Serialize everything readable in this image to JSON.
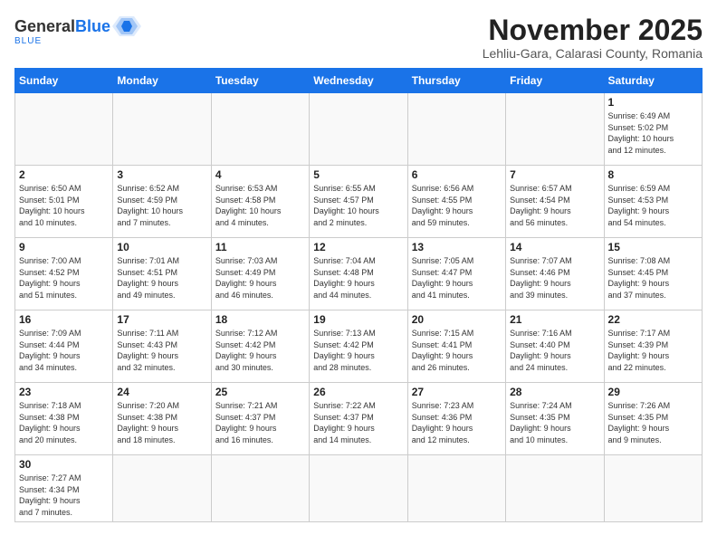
{
  "header": {
    "logo_general": "General",
    "logo_blue": "Blue",
    "title": "November 2025",
    "subtitle": "Lehliu-Gara, Calarasi County, Romania"
  },
  "weekdays": [
    "Sunday",
    "Monday",
    "Tuesday",
    "Wednesday",
    "Thursday",
    "Friday",
    "Saturday"
  ],
  "weeks": [
    [
      {
        "day": "",
        "info": ""
      },
      {
        "day": "",
        "info": ""
      },
      {
        "day": "",
        "info": ""
      },
      {
        "day": "",
        "info": ""
      },
      {
        "day": "",
        "info": ""
      },
      {
        "day": "",
        "info": ""
      },
      {
        "day": "1",
        "info": "Sunrise: 6:49 AM\nSunset: 5:02 PM\nDaylight: 10 hours\nand 12 minutes."
      }
    ],
    [
      {
        "day": "2",
        "info": "Sunrise: 6:50 AM\nSunset: 5:01 PM\nDaylight: 10 hours\nand 10 minutes."
      },
      {
        "day": "3",
        "info": "Sunrise: 6:52 AM\nSunset: 4:59 PM\nDaylight: 10 hours\nand 7 minutes."
      },
      {
        "day": "4",
        "info": "Sunrise: 6:53 AM\nSunset: 4:58 PM\nDaylight: 10 hours\nand 4 minutes."
      },
      {
        "day": "5",
        "info": "Sunrise: 6:55 AM\nSunset: 4:57 PM\nDaylight: 10 hours\nand 2 minutes."
      },
      {
        "day": "6",
        "info": "Sunrise: 6:56 AM\nSunset: 4:55 PM\nDaylight: 9 hours\nand 59 minutes."
      },
      {
        "day": "7",
        "info": "Sunrise: 6:57 AM\nSunset: 4:54 PM\nDaylight: 9 hours\nand 56 minutes."
      },
      {
        "day": "8",
        "info": "Sunrise: 6:59 AM\nSunset: 4:53 PM\nDaylight: 9 hours\nand 54 minutes."
      }
    ],
    [
      {
        "day": "9",
        "info": "Sunrise: 7:00 AM\nSunset: 4:52 PM\nDaylight: 9 hours\nand 51 minutes."
      },
      {
        "day": "10",
        "info": "Sunrise: 7:01 AM\nSunset: 4:51 PM\nDaylight: 9 hours\nand 49 minutes."
      },
      {
        "day": "11",
        "info": "Sunrise: 7:03 AM\nSunset: 4:49 PM\nDaylight: 9 hours\nand 46 minutes."
      },
      {
        "day": "12",
        "info": "Sunrise: 7:04 AM\nSunset: 4:48 PM\nDaylight: 9 hours\nand 44 minutes."
      },
      {
        "day": "13",
        "info": "Sunrise: 7:05 AM\nSunset: 4:47 PM\nDaylight: 9 hours\nand 41 minutes."
      },
      {
        "day": "14",
        "info": "Sunrise: 7:07 AM\nSunset: 4:46 PM\nDaylight: 9 hours\nand 39 minutes."
      },
      {
        "day": "15",
        "info": "Sunrise: 7:08 AM\nSunset: 4:45 PM\nDaylight: 9 hours\nand 37 minutes."
      }
    ],
    [
      {
        "day": "16",
        "info": "Sunrise: 7:09 AM\nSunset: 4:44 PM\nDaylight: 9 hours\nand 34 minutes."
      },
      {
        "day": "17",
        "info": "Sunrise: 7:11 AM\nSunset: 4:43 PM\nDaylight: 9 hours\nand 32 minutes."
      },
      {
        "day": "18",
        "info": "Sunrise: 7:12 AM\nSunset: 4:42 PM\nDaylight: 9 hours\nand 30 minutes."
      },
      {
        "day": "19",
        "info": "Sunrise: 7:13 AM\nSunset: 4:42 PM\nDaylight: 9 hours\nand 28 minutes."
      },
      {
        "day": "20",
        "info": "Sunrise: 7:15 AM\nSunset: 4:41 PM\nDaylight: 9 hours\nand 26 minutes."
      },
      {
        "day": "21",
        "info": "Sunrise: 7:16 AM\nSunset: 4:40 PM\nDaylight: 9 hours\nand 24 minutes."
      },
      {
        "day": "22",
        "info": "Sunrise: 7:17 AM\nSunset: 4:39 PM\nDaylight: 9 hours\nand 22 minutes."
      }
    ],
    [
      {
        "day": "23",
        "info": "Sunrise: 7:18 AM\nSunset: 4:38 PM\nDaylight: 9 hours\nand 20 minutes."
      },
      {
        "day": "24",
        "info": "Sunrise: 7:20 AM\nSunset: 4:38 PM\nDaylight: 9 hours\nand 18 minutes."
      },
      {
        "day": "25",
        "info": "Sunrise: 7:21 AM\nSunset: 4:37 PM\nDaylight: 9 hours\nand 16 minutes."
      },
      {
        "day": "26",
        "info": "Sunrise: 7:22 AM\nSunset: 4:37 PM\nDaylight: 9 hours\nand 14 minutes."
      },
      {
        "day": "27",
        "info": "Sunrise: 7:23 AM\nSunset: 4:36 PM\nDaylight: 9 hours\nand 12 minutes."
      },
      {
        "day": "28",
        "info": "Sunrise: 7:24 AM\nSunset: 4:35 PM\nDaylight: 9 hours\nand 10 minutes."
      },
      {
        "day": "29",
        "info": "Sunrise: 7:26 AM\nSunset: 4:35 PM\nDaylight: 9 hours\nand 9 minutes."
      }
    ],
    [
      {
        "day": "30",
        "info": "Sunrise: 7:27 AM\nSunset: 4:34 PM\nDaylight: 9 hours\nand 7 minutes."
      },
      {
        "day": "",
        "info": ""
      },
      {
        "day": "",
        "info": ""
      },
      {
        "day": "",
        "info": ""
      },
      {
        "day": "",
        "info": ""
      },
      {
        "day": "",
        "info": ""
      },
      {
        "day": "",
        "info": ""
      }
    ]
  ]
}
